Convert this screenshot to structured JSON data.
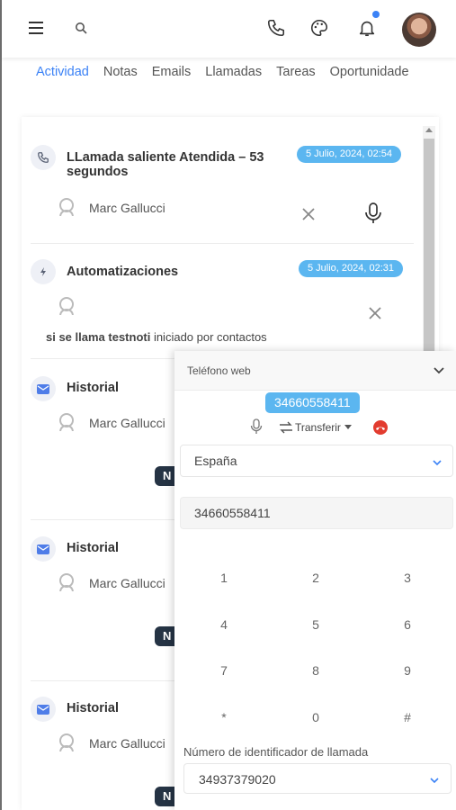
{
  "topbar": {
    "icons": [
      "menu-icon",
      "search-icon",
      "phone-icon",
      "palette-icon",
      "bell-icon"
    ],
    "notification_dot_color": "#3b82f6"
  },
  "tabs": [
    "Actividad",
    "Notas",
    "Emails",
    "Llamadas",
    "Tareas",
    "Oportunidade"
  ],
  "active_tab": "Actividad",
  "feed": {
    "call": {
      "title_line1": "LLamada saliente Atendida – 53",
      "title_line2": "segundos",
      "date": "5 Julio, 2024, 02:54",
      "person": "Marc Gallucci"
    },
    "automation": {
      "title": "Automatizaciones",
      "date": "5 Julio, 2024, 02:31",
      "note_bold": "si se llama testnoti",
      "note_rest": " iniciado por contactos"
    },
    "history": [
      {
        "title": "Historial",
        "person": "Marc Gallucci",
        "chip": "N"
      },
      {
        "title": "Historial",
        "person": "Marc Gallucci",
        "chip": "N"
      },
      {
        "title": "Historial",
        "person": "Marc Gallucci",
        "chip": "N"
      }
    ]
  },
  "phone_panel": {
    "title": "Teléfono web",
    "number": "34660558411",
    "transfer_label": "Transferir",
    "country": "España",
    "dial_input": "34660558411",
    "keypad": [
      "1",
      "2",
      "3",
      "4",
      "5",
      "6",
      "7",
      "8",
      "9",
      "*",
      "0",
      "#"
    ],
    "caller_id_label": "Número de identificador de llamada",
    "caller_id_value": "34937379020"
  },
  "colors": {
    "accent": "#3b82f6",
    "badge": "#5bb6f0",
    "hangup": "#e23c2f",
    "chip": "#253344"
  }
}
